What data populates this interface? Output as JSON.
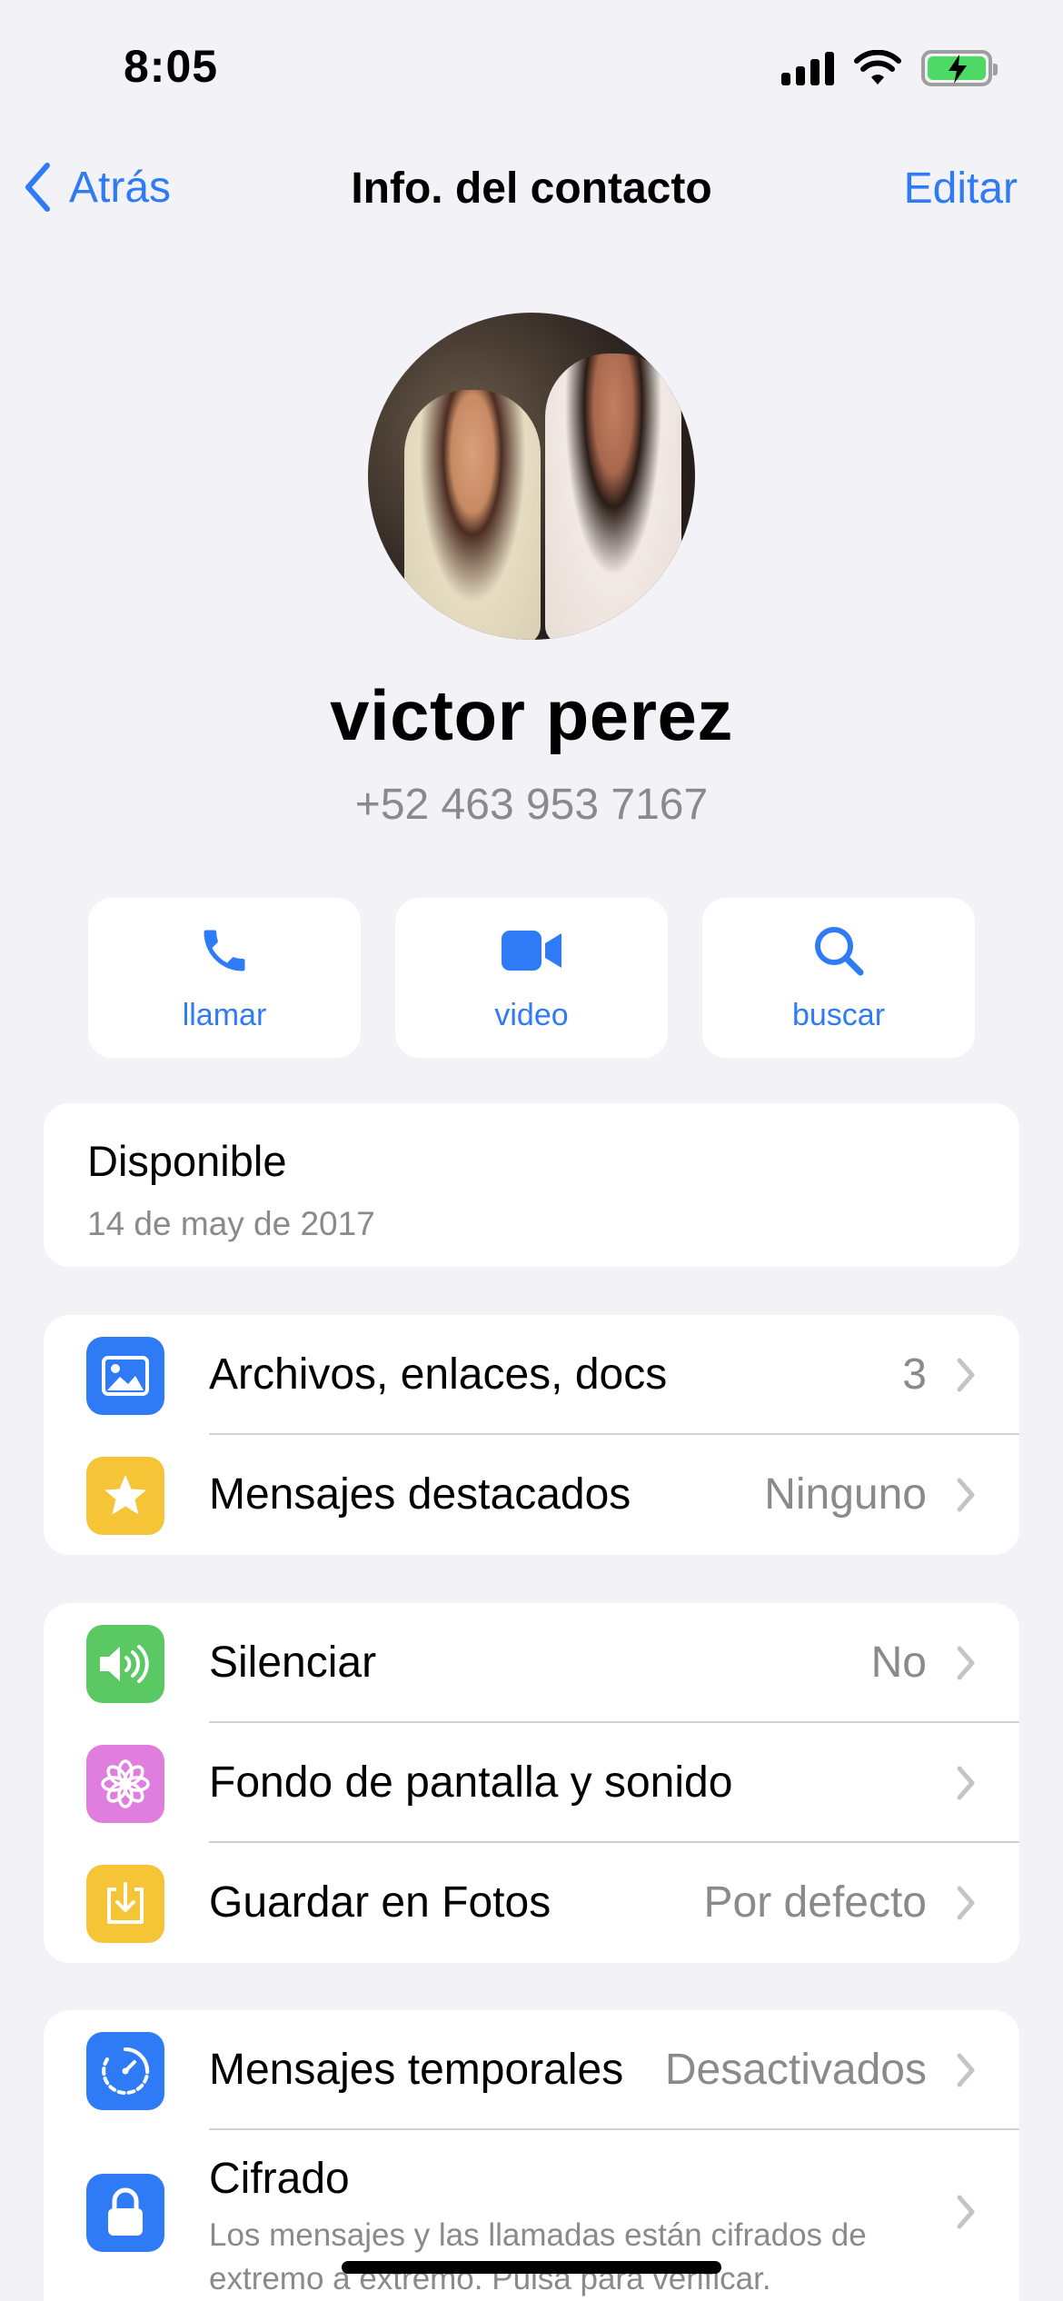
{
  "status_bar": {
    "time": "8:05"
  },
  "nav": {
    "back_label": "Atrás",
    "title": "Info. del contacto",
    "edit_label": "Editar"
  },
  "profile": {
    "name": "victor perez",
    "phone": "+52 463 953 7167"
  },
  "actions": [
    {
      "label": "llamar",
      "icon": "phone-icon"
    },
    {
      "label": "video",
      "icon": "video-camera-icon"
    },
    {
      "label": "buscar",
      "icon": "search-icon"
    }
  ],
  "about": {
    "status": "Disponible",
    "date": "14 de may de 2017"
  },
  "media_section": [
    {
      "label": "Archivos, enlaces, docs",
      "value": "3",
      "icon": "photo-icon",
      "icon_color": "#2f7bf5"
    },
    {
      "label": "Mensajes destacados",
      "value": "Ninguno",
      "icon": "star-icon",
      "icon_color": "#f5c437"
    }
  ],
  "settings_section": [
    {
      "label": "Silenciar",
      "value": "No",
      "icon": "speaker-icon",
      "icon_color": "#5ac863"
    },
    {
      "label": "Fondo de pantalla y sonido",
      "value": "",
      "icon": "flower-icon",
      "icon_color": "#e07ee0"
    },
    {
      "label": "Guardar en Fotos",
      "value": "Por defecto",
      "icon": "download-icon",
      "icon_color": "#f5c437"
    }
  ],
  "privacy_section": [
    {
      "label": "Mensajes temporales",
      "value": "Desactivados",
      "icon": "timer-icon",
      "icon_color": "#2f7bf5"
    },
    {
      "label": "Cifrado",
      "sub": "Los mensajes y las llamadas están cifrados de extremo a extremo. Pulsa para verificar.",
      "icon": "lock-icon",
      "icon_color": "#2f7bf5"
    }
  ]
}
